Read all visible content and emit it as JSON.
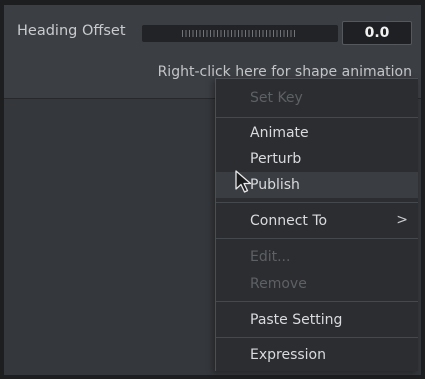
{
  "inspector": {
    "heading_label": "Heading Offset",
    "heading_value": "0.0",
    "hint": "Right-click here for shape animation"
  },
  "context_menu": {
    "set_key": "Set Key",
    "animate": "Animate",
    "perturb": "Perturb",
    "publish": "Publish",
    "connect_to": "Connect To",
    "connect_to_arrow": ">",
    "edit": "Edit...",
    "remove": "Remove",
    "paste_setting": "Paste Setting",
    "expression": "Expression"
  },
  "icons": {
    "submenu": "chevron-right-icon",
    "pointer": "mouse-pointer-icon"
  },
  "colors": {
    "background": "#3b3e43",
    "menu_background": "#2b2d30",
    "disabled_text": "#5d6065",
    "enabled_text": "#d9dbde"
  }
}
